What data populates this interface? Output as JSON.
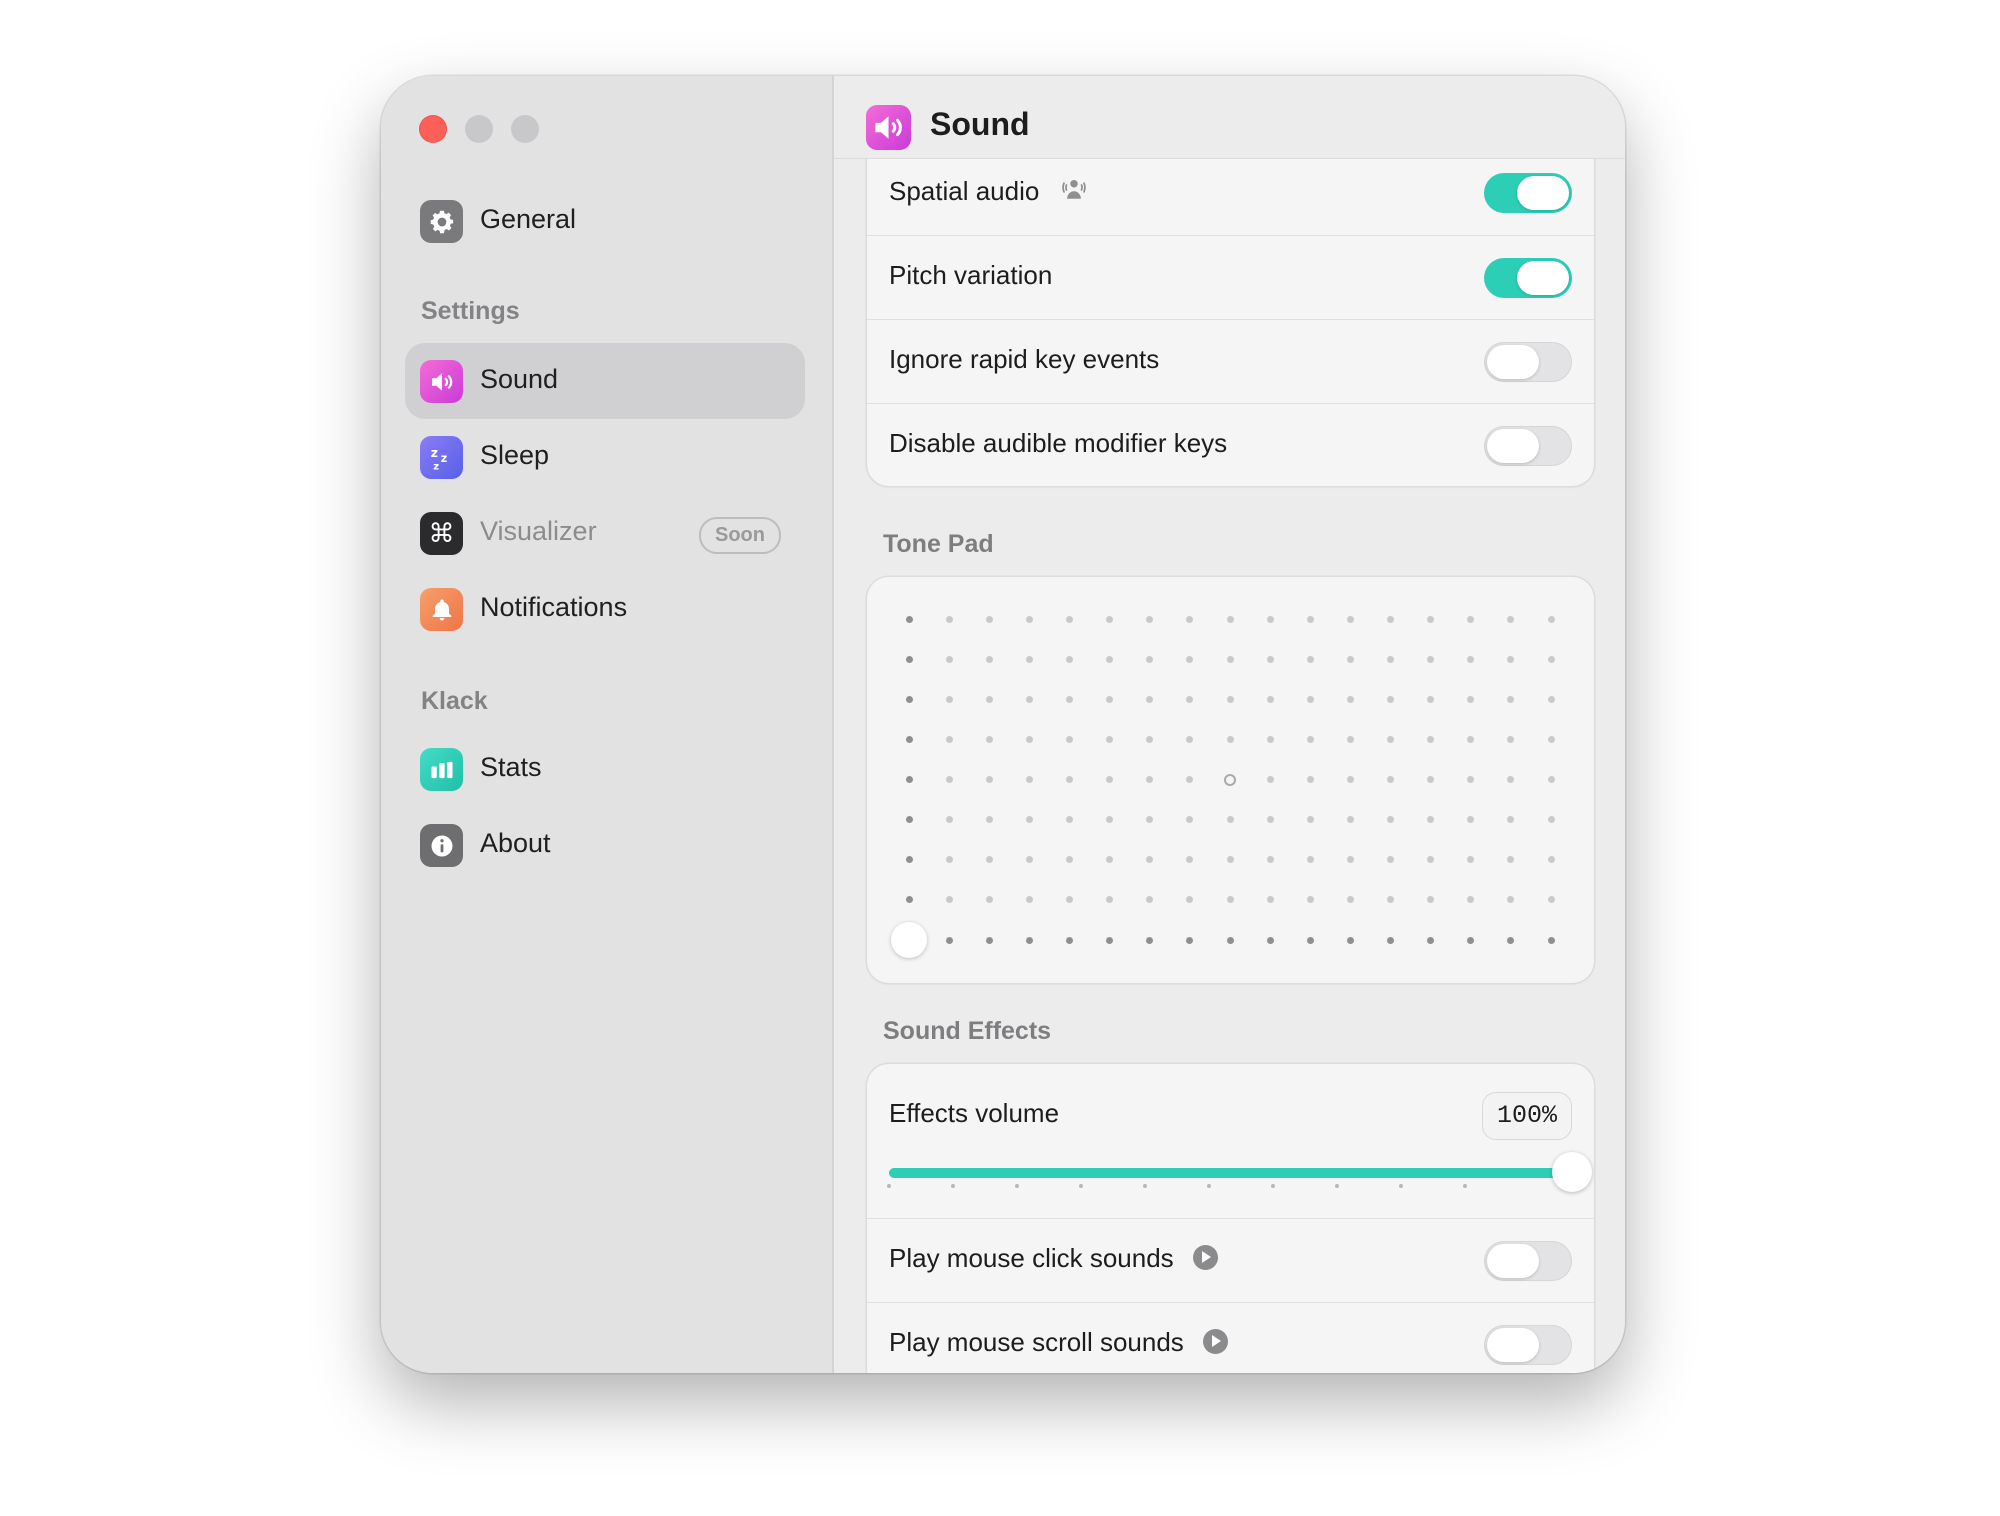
{
  "sidebar": {
    "items": [
      {
        "label": "General",
        "icon": "gear-icon",
        "color": "#7a7a7c"
      },
      {
        "label": "Sound",
        "icon": "speaker-icon",
        "color": "#e455d8",
        "selected": true
      },
      {
        "label": "Sleep",
        "icon": "sleep-icon",
        "color": "#6d6cf0"
      },
      {
        "label": "Visualizer",
        "icon": "command-icon",
        "color": "#2b2b2d",
        "badge": "Soon"
      },
      {
        "label": "Notifications",
        "icon": "bell-icon",
        "color": "#f08850"
      },
      {
        "label": "Stats",
        "icon": "bar-chart-icon",
        "color": "#2ccfb6"
      },
      {
        "label": "About",
        "icon": "info-icon",
        "color": "#6e6e70"
      }
    ],
    "sections": {
      "settings": "Settings",
      "klack": "Klack"
    }
  },
  "header": {
    "title": "Sound",
    "icon": "speaker-icon"
  },
  "audio_settings": [
    {
      "label": "Spatial audio",
      "enabled": true
    },
    {
      "label": "Pitch variation",
      "enabled": true
    },
    {
      "label": "Ignore rapid key events",
      "enabled": false
    },
    {
      "label": "Disable audible modifier keys",
      "enabled": false
    }
  ],
  "tone_pad": {
    "title": "Tone Pad",
    "columns": 17,
    "rows": 9,
    "selected_column": 1,
    "selected_row": 9
  },
  "sound_effects": {
    "title": "Sound Effects",
    "volume_label": "Effects volume",
    "volume_value": "100%",
    "volume_fraction": 1.0,
    "rows": [
      {
        "label": "Play mouse click sounds",
        "enabled": false
      },
      {
        "label": "Play mouse scroll sounds",
        "enabled": false
      }
    ]
  },
  "colors": {
    "accent": "#2ccfb6",
    "close": "#fe5f57"
  }
}
